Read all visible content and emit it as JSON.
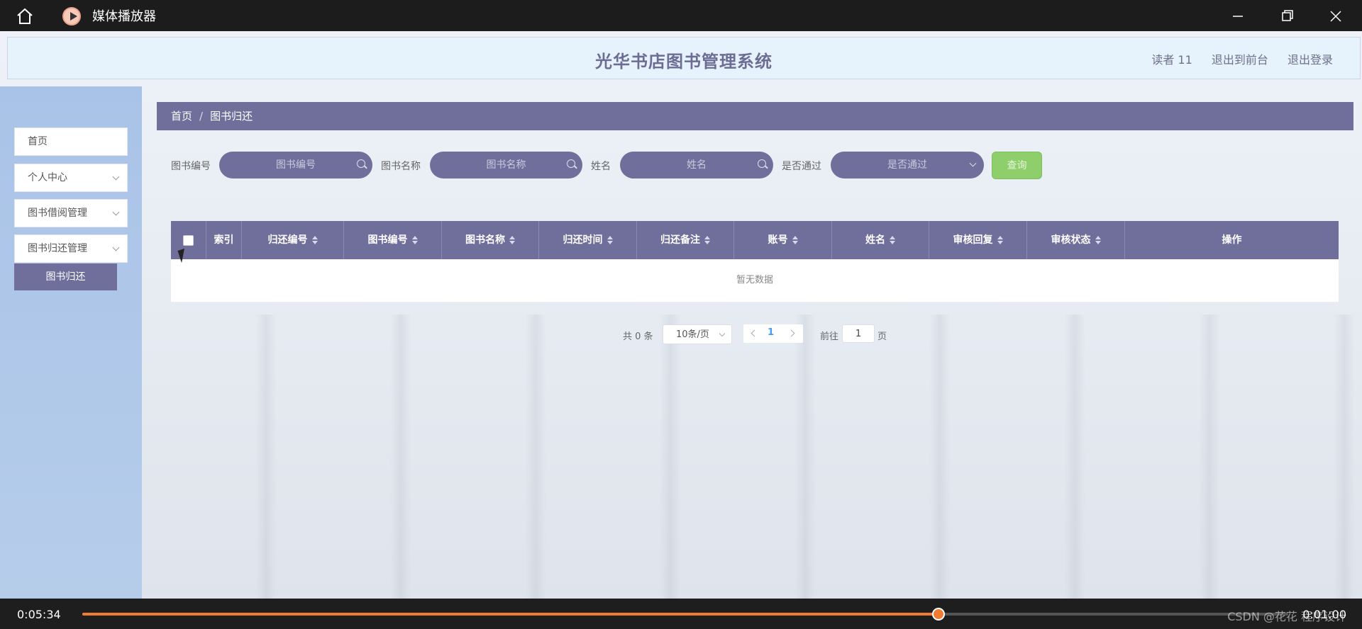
{
  "titlebar": {
    "app_title": "媒体播放器"
  },
  "header": {
    "site_title": "光华书店图书管理系统",
    "user": "读者 11",
    "to_front": "退出到前台",
    "logout": "退出登录"
  },
  "sidebar": {
    "items": [
      {
        "label": "首页"
      },
      {
        "label": "个人中心"
      },
      {
        "label": "图书借阅管理"
      },
      {
        "label": "图书归还管理"
      }
    ],
    "active_sub": "图书归还"
  },
  "breadcrumb": {
    "home": "首页",
    "sep": "/",
    "current": "图书归还"
  },
  "search": {
    "f1_label": "图书编号",
    "f1_placeholder": "图书编号",
    "f2_label": "图书名称",
    "f2_placeholder": "图书名称",
    "f3_label": "姓名",
    "f3_placeholder": "姓名",
    "f4_label": "是否通过",
    "f4_placeholder": "是否通过",
    "query": "查询"
  },
  "table": {
    "columns": [
      "索引",
      "归还编号",
      "图书编号",
      "图书名称",
      "归还时间",
      "归还备注",
      "账号",
      "姓名",
      "审核回复",
      "审核状态",
      "操作"
    ],
    "empty": "暂无数据"
  },
  "pager": {
    "total": "共 0 条",
    "size": "10条/页",
    "current": "1",
    "goto": "前往",
    "goto_value": "1",
    "suffix": "页"
  },
  "player": {
    "elapsed": "0:05:34",
    "total": "0:01:00",
    "progress": 0.71,
    "watermark": "CSDN @花花 程序设计"
  },
  "colors": {
    "accent": "#706f9b",
    "progress": "#f07c34",
    "query_button": "#8fcf6b"
  }
}
